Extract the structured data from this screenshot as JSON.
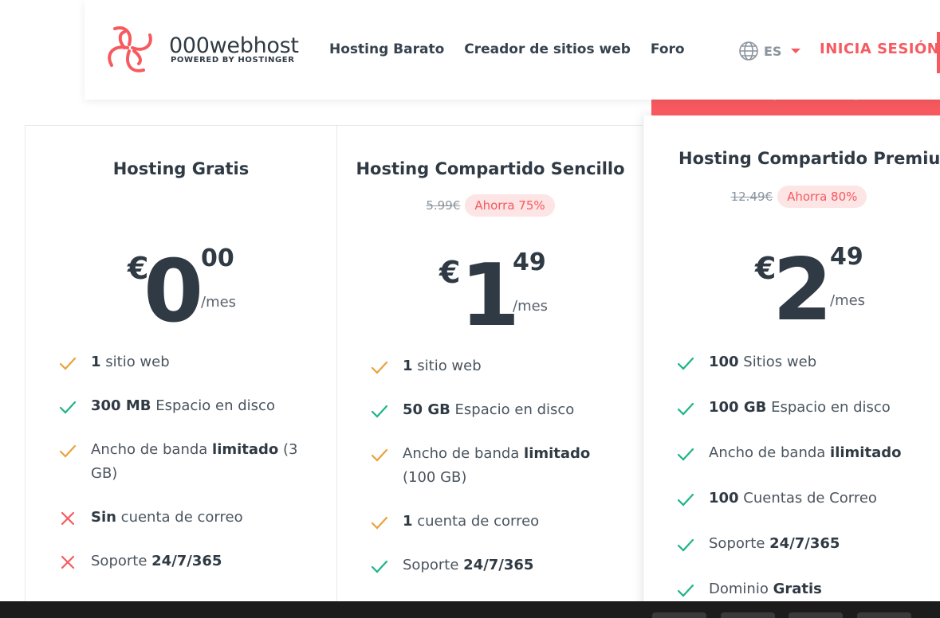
{
  "header": {
    "brand_name": "000webhost",
    "brand_sub": "POWERED BY HOSTINGER",
    "nav": [
      "Hosting Barato",
      "Creador de sitios web",
      "Foro"
    ],
    "language": "ES",
    "login": "INICIA SESIÓN"
  },
  "ribbon": "MÁS VENDIDO",
  "plans": [
    {
      "title": "Hosting Gratis",
      "currency": "€",
      "amount": "0",
      "cents": "00",
      "period": "/mes",
      "features": [
        {
          "icon": "check-icon",
          "color": "#e8a33d",
          "bold": "1",
          "text": " sitio web"
        },
        {
          "icon": "check-icon",
          "color": "#1db489",
          "bold": "300 MB",
          "text": " Espacio en disco"
        },
        {
          "icon": "check-icon",
          "color": "#e8a33d",
          "pre": "Ancho de banda ",
          "bold": "limitado",
          "text": " (3 GB)"
        },
        {
          "icon": "cross-icon",
          "color": "#f65a5f",
          "bold": "Sin",
          "text": " cuenta de correo"
        },
        {
          "icon": "cross-icon",
          "color": "#f65a5f",
          "pre": "Soporte ",
          "bold": "24/7/365",
          "text": ""
        }
      ]
    },
    {
      "title": "Hosting Compartido Sencillo",
      "old_price": "5.99€",
      "save": "Ahorra 75%",
      "currency": "€",
      "amount": "1",
      "cents": "49",
      "period": "/mes",
      "features": [
        {
          "icon": "check-icon",
          "color": "#e8a33d",
          "bold": "1",
          "text": " sitio web"
        },
        {
          "icon": "check-icon",
          "color": "#1db489",
          "bold": "50 GB",
          "text": " Espacio en disco"
        },
        {
          "icon": "check-icon",
          "color": "#e8a33d",
          "pre": "Ancho de banda ",
          "bold": "limitado",
          "text": " (100 GB)"
        },
        {
          "icon": "check-icon",
          "color": "#e8a33d",
          "bold": "1",
          "text": " cuenta de correo"
        },
        {
          "icon": "check-icon",
          "color": "#1db489",
          "pre": "Soporte ",
          "bold": "24/7/365",
          "text": ""
        }
      ]
    },
    {
      "title": "Hosting Compartido Premium",
      "old_price": "12.49€",
      "save": "Ahorra 80%",
      "currency": "€",
      "amount": "2",
      "cents": "49",
      "period": "/mes",
      "features": [
        {
          "icon": "check-icon",
          "color": "#1db489",
          "bold": "100",
          "text": " Sitios web"
        },
        {
          "icon": "check-icon",
          "color": "#1db489",
          "bold": "100 GB",
          "text": " Espacio en disco"
        },
        {
          "icon": "check-icon",
          "color": "#1db489",
          "pre": "Ancho de banda ",
          "bold": "ilimitado",
          "text": ""
        },
        {
          "icon": "check-icon",
          "color": "#1db489",
          "bold": "100",
          "text": " Cuentas de Correo"
        },
        {
          "icon": "check-icon",
          "color": "#1db489",
          "pre": "Soporte ",
          "bold": "24/7/365",
          "text": ""
        },
        {
          "icon": "check-icon",
          "color": "#1db489",
          "pre": "Dominio ",
          "bold": "Gratis",
          "text": ""
        }
      ]
    }
  ]
}
